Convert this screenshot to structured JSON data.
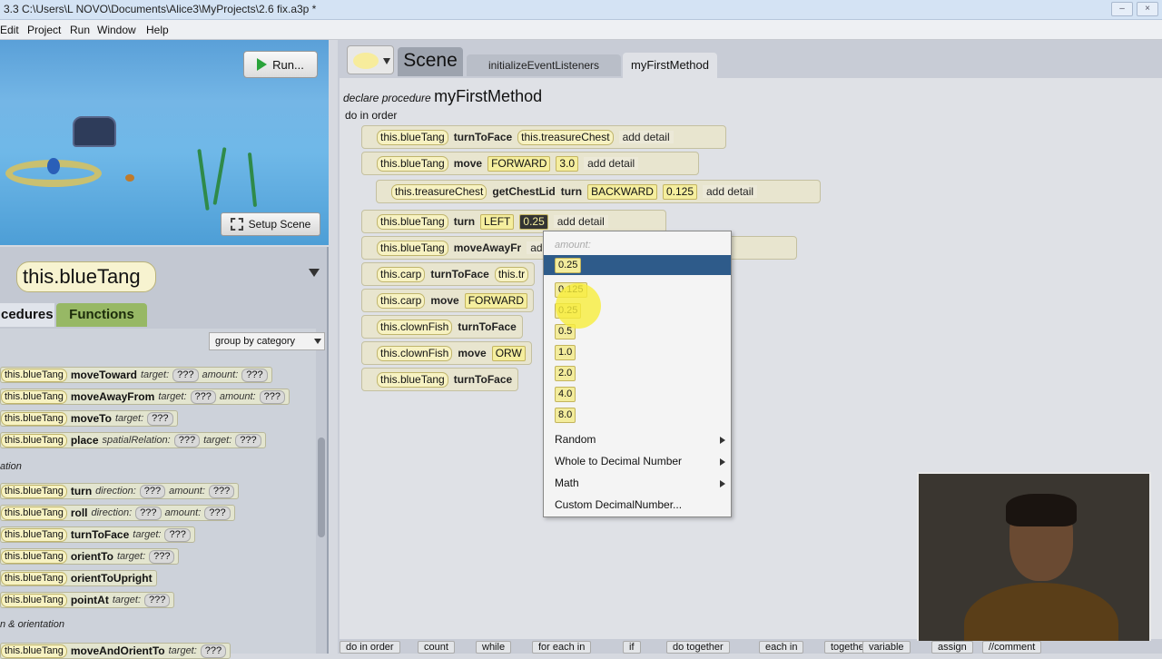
{
  "window": {
    "title": "3.3 C:\\Users\\L NOVO\\Documents\\Alice3\\MyProjects\\2.6 fix.a3p *"
  },
  "menu": [
    "Edit",
    "Project",
    "Run",
    "Window",
    "Help"
  ],
  "scene_view": {
    "run_label": "Run...",
    "setup_label": "Setup Scene"
  },
  "left_panel": {
    "object": "this.blueTang",
    "tabs": [
      "cedures",
      "Functions"
    ],
    "group": "group by category",
    "sections": [
      "ation",
      "n & orientation"
    ],
    "tiles": [
      {
        "obj": "this.blueTang",
        "method": "moveToward",
        "params": [
          [
            "target:",
            "???"
          ],
          [
            "amount:",
            "???"
          ]
        ]
      },
      {
        "obj": "this.blueTang",
        "method": "moveAwayFrom",
        "params": [
          [
            "target:",
            "???"
          ],
          [
            "amount:",
            "???"
          ]
        ]
      },
      {
        "obj": "this.blueTang",
        "method": "moveTo",
        "params": [
          [
            "target:",
            "???"
          ]
        ]
      },
      {
        "obj": "this.blueTang",
        "method": "place",
        "params": [
          [
            "spatialRelation:",
            "???"
          ],
          [
            "target:",
            "???"
          ]
        ]
      },
      {
        "obj": "this.blueTang",
        "method": "turn",
        "params": [
          [
            "direction:",
            "???"
          ],
          [
            "amount:",
            "???"
          ]
        ]
      },
      {
        "obj": "this.blueTang",
        "method": "roll",
        "params": [
          [
            "direction:",
            "???"
          ],
          [
            "amount:",
            "???"
          ]
        ]
      },
      {
        "obj": "this.blueTang",
        "method": "turnToFace",
        "params": [
          [
            "target:",
            "???"
          ]
        ]
      },
      {
        "obj": "this.blueTang",
        "method": "orientTo",
        "params": [
          [
            "target:",
            "???"
          ]
        ]
      },
      {
        "obj": "this.blueTang",
        "method": "orientToUpright",
        "params": []
      },
      {
        "obj": "this.blueTang",
        "method": "pointAt",
        "params": [
          [
            "target:",
            "???"
          ]
        ]
      },
      {
        "obj": "this.blueTang",
        "method": "moveAndOrientTo",
        "params": [
          [
            "target:",
            "???"
          ]
        ]
      }
    ]
  },
  "editor": {
    "scene_tab": "Scene",
    "tabs": [
      "initializeEventListeners",
      "myFirstMethod"
    ],
    "declare": "declare procedure",
    "method_name": "myFirstMethod",
    "do_in_order": "do in order",
    "statements": [
      {
        "parts": [
          "this.blueTang",
          "turnToFace",
          "this.treasureChest",
          "add detail"
        ]
      },
      {
        "parts": [
          "this.blueTang",
          "move",
          "FORWARD",
          "3.0",
          "add detail"
        ]
      },
      {
        "parts": [
          "this.treasureChest",
          "getChestLid",
          "turn",
          "BACKWARD",
          "0.125",
          "add detail"
        ]
      },
      {
        "parts": [
          "this.blueTang",
          "turn",
          "LEFT",
          "0.25",
          "add detail"
        ]
      },
      {
        "parts": [
          "this.blueTang",
          "moveAwayFr",
          "add detail"
        ]
      },
      {
        "parts": [
          "this.carp",
          "turnToFace",
          "this.tr"
        ]
      },
      {
        "parts": [
          "this.carp",
          "move",
          "FORWARD"
        ]
      },
      {
        "parts": [
          "this.clownFish",
          "turnToFace"
        ]
      },
      {
        "parts": [
          "this.clownFish",
          "move",
          "ORW"
        ]
      },
      {
        "parts": [
          "this.blueTang",
          "turnToFace"
        ]
      }
    ]
  },
  "popup": {
    "header": "amount:",
    "options": [
      "0.25",
      "0.125",
      "0.25",
      "0.5",
      "1.0",
      "2.0",
      "4.0",
      "8.0"
    ],
    "menu_items": [
      "Random",
      "Whole to Decimal Number",
      "Math",
      "Custom DecimalNumber..."
    ]
  },
  "bottom_bar": [
    "do in order",
    "count",
    "while",
    "for each in",
    "if",
    "do together",
    "each in",
    "together",
    "variable",
    "assign",
    "//comment"
  ]
}
